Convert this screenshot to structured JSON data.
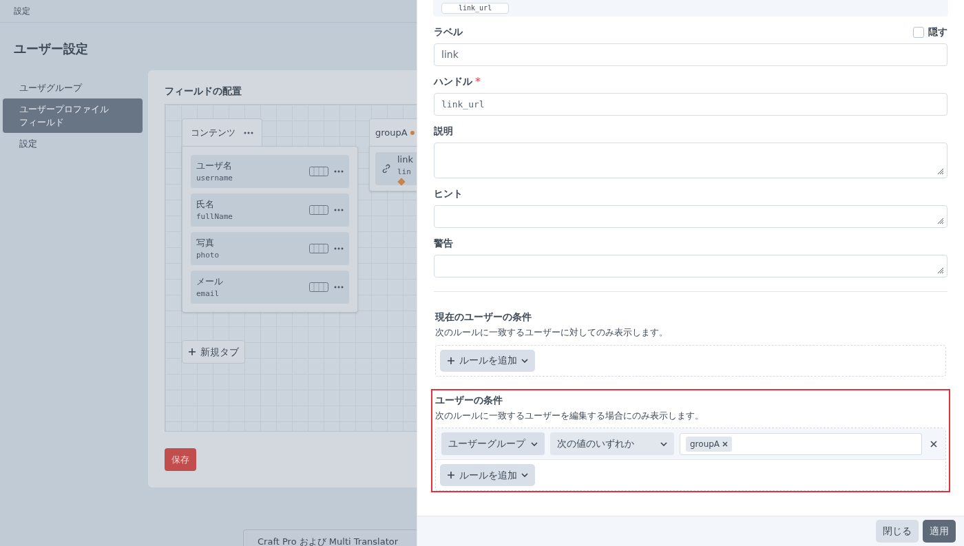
{
  "breadcrumb": "設定",
  "page_title": "ユーザー設定",
  "sidebar": {
    "items": [
      {
        "label": "ユーザグループ",
        "selected": false
      },
      {
        "label": "ユーザープロファイルフィールド",
        "selected": true
      },
      {
        "label": "設定",
        "selected": false
      }
    ]
  },
  "layout": {
    "title": "フィールドの配置",
    "tabs": [
      {
        "name": "コンテンツ",
        "changed": false,
        "fields": [
          {
            "label": "ユーザ名",
            "handle": "username",
            "changed": false
          },
          {
            "label": "氏名",
            "handle": "fullName",
            "changed": false
          },
          {
            "label": "写真",
            "handle": "photo",
            "changed": false
          },
          {
            "label": "メール",
            "handle": "email",
            "changed": false
          }
        ]
      },
      {
        "name": "groupA",
        "changed": true,
        "fields": [
          {
            "label": "link",
            "handle": "lin",
            "changed": true
          }
        ]
      }
    ],
    "new_tab_button": "新規タブ"
  },
  "save_button": "保存",
  "notice": "Craft Pro および Multi Translator",
  "drawer": {
    "handle_chip": "link_url",
    "fields": [
      {
        "kind": "input",
        "label": "ラベル",
        "value": "link",
        "mono": false,
        "hide": {
          "label": "隠す",
          "checked": false
        }
      },
      {
        "kind": "input",
        "label": "ハンドル",
        "value": "link_url",
        "mono": true,
        "required_mark": "*"
      },
      {
        "kind": "textarea",
        "label": "説明",
        "tall": true
      },
      {
        "kind": "textarea",
        "label": "ヒント",
        "tall": false
      },
      {
        "kind": "textarea",
        "label": "警告",
        "tall": false
      }
    ],
    "conditions": [
      {
        "title": "現在のユーザーの条件",
        "description": "次のルールに一致するユーザーに対してのみ表示します。",
        "add_rule": "ルールを追加"
      },
      {
        "title": "ユーザーの条件",
        "description": "次のルールに一致するユーザーを編集する場合にのみ表示します。",
        "highlighted": true,
        "rules": [
          {
            "attribute": "ユーザーグループ",
            "operator": "次の値のいずれか",
            "values": [
              "groupA"
            ]
          }
        ],
        "add_rule": "ルールを追加"
      }
    ],
    "buttons": [
      {
        "label": "閉じる",
        "kind": "secondary"
      },
      {
        "label": "適用",
        "kind": "primary"
      }
    ]
  }
}
